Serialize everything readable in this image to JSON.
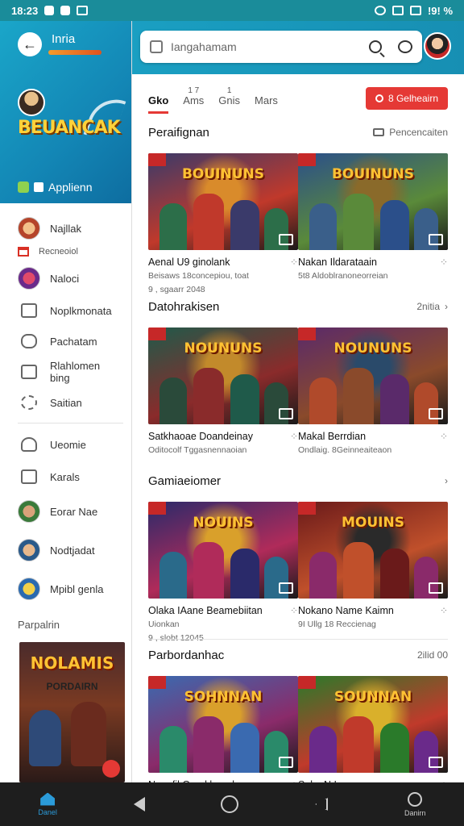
{
  "status_bar": {
    "time": "18:23",
    "battery": "!9! %"
  },
  "drawer": {
    "header": {
      "title": "Inria",
      "logo_text": "BEUANCAK",
      "app_label": "Applienn"
    },
    "items": [
      {
        "label": "Najllak",
        "kind": "avatar"
      },
      {
        "label": "Recneoiol",
        "kind": "gmail"
      },
      {
        "label": "Naloci",
        "kind": "avatar"
      },
      {
        "label": "Noplkmonata",
        "kind": "mail-icon"
      },
      {
        "label": "Pachatam",
        "kind": "chat-icon"
      },
      {
        "label": "Rlahlomen bing",
        "kind": "check-icon"
      },
      {
        "label": "Saitian",
        "kind": "gear-icon"
      },
      {
        "label": "Ueomie",
        "kind": "person-icon"
      },
      {
        "label": "Karals",
        "kind": "mail-icon"
      },
      {
        "label": "Eorar Nae",
        "kind": "avatar"
      },
      {
        "label": "Nodtjadat",
        "kind": "avatar"
      },
      {
        "label": "Mpibl genla",
        "kind": "avatar"
      }
    ],
    "section_label": "Parpalrin",
    "poster": {
      "title": "NOLAMIS",
      "subtitle": "PORDAIRN"
    }
  },
  "search": {
    "placeholder": "Iangahamam"
  },
  "tabs": [
    {
      "label": "Gko",
      "sup": "",
      "active": true
    },
    {
      "label": "Ams",
      "sup": "1 7",
      "active": false
    },
    {
      "label": "Gnis",
      "sup": "1",
      "active": false
    },
    {
      "label": "Mars",
      "sup": "",
      "active": false
    }
  ],
  "action_button": "8 Gelheairn",
  "sections": [
    {
      "title": "Peraifignan",
      "right": "Pencencaiten",
      "cards": [
        {
          "logo": "BOUINUNS",
          "title": "Aenal U9 ginolank",
          "sub1": "Beisaws 18concepiou, toat",
          "sub2": "9 , sgaarr 2048",
          "theme": "a"
        },
        {
          "logo": "BOUINUNS",
          "title": "Nakan Ildarataain",
          "sub1": "5t8 Aldoblranoneorreian",
          "sub2": "",
          "theme": "b"
        }
      ]
    },
    {
      "title": "Datohrakisen",
      "right": "2nitia",
      "cards": [
        {
          "logo": "NOUNUNS",
          "title": "Satkhaoae Doandeinay",
          "sub1": "Oditocolf Tggasnennaoian",
          "sub2": "",
          "theme": "c"
        },
        {
          "logo": "NOUNUNS",
          "title": "Makal Berrdian",
          "sub1": "Ondlaig. 8Geinneaiteaon",
          "sub2": "",
          "theme": "d"
        }
      ]
    },
    {
      "title": "Gamiaeiomer",
      "right": "",
      "cards": [
        {
          "logo": "NOUINS",
          "title": "Olaka IAane Beamebiitan",
          "sub1": "Uionkan",
          "sub2": "9 , slobt 12045",
          "theme": "e"
        },
        {
          "logo": "MOUINS",
          "title": "Nokano Name Kaimn",
          "sub1": "9I Ullg 18 Reccienag",
          "sub2": "",
          "theme": "f"
        }
      ]
    },
    {
      "title": "Parbordanhac",
      "right": "2ilid 00",
      "cards": [
        {
          "logo": "SOHNNAN",
          "title": "Nanafil Good benekeg",
          "sub1": "",
          "sub2": "",
          "theme": "g"
        },
        {
          "logo": "SOUNNAN",
          "title": "Saka N Ipan",
          "sub1": "",
          "sub2": "",
          "theme": "h"
        }
      ]
    }
  ],
  "nav": {
    "home_label": "Danel",
    "profile_label": "Danirn"
  },
  "colors": {
    "accent": "#e53935",
    "header": "#1a9fc2",
    "nav_active": "#2b9bd9"
  }
}
